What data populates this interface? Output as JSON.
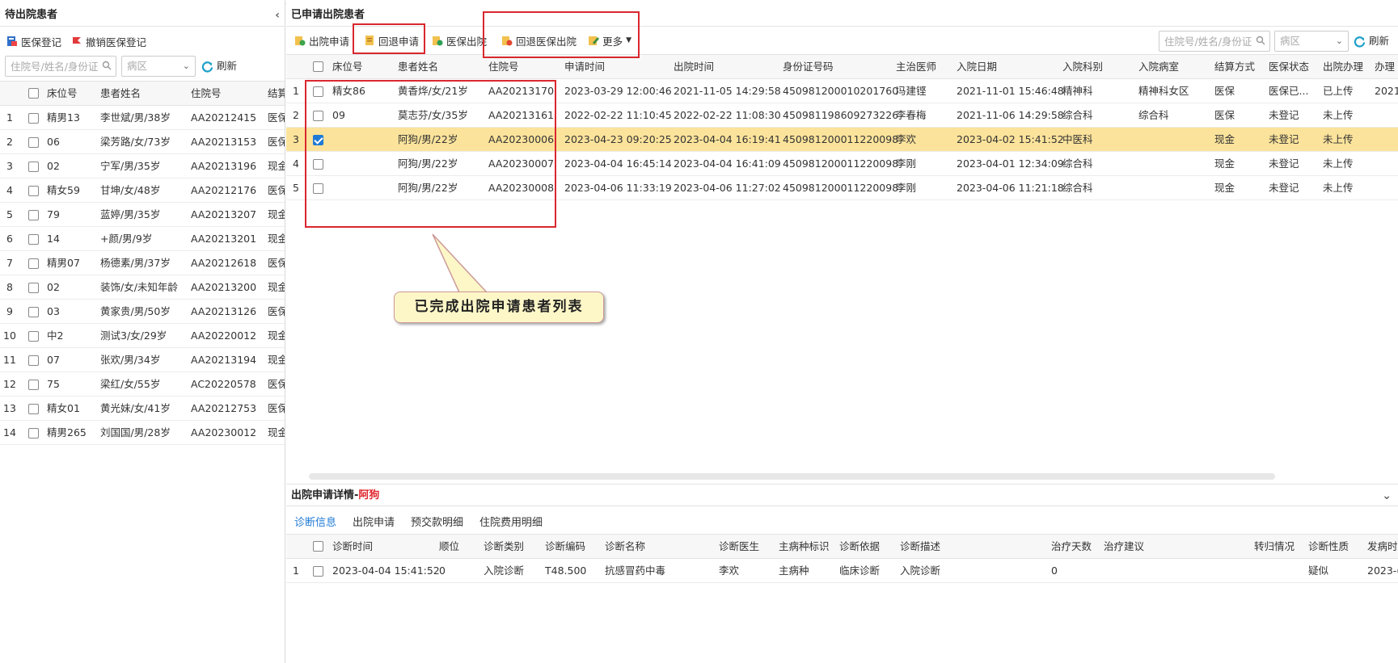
{
  "left": {
    "title": "待出院患者",
    "toolbar": {
      "register": "医保登记",
      "cancel_register": "撤销医保登记"
    },
    "search_placeholder": "住院号/姓名/身份证",
    "ward_placeholder": "病区",
    "refresh": "刷新",
    "columns": [
      "床位号",
      "患者姓名",
      "住院号",
      "结算"
    ],
    "rows": [
      {
        "n": "1",
        "bed": "精男13",
        "name": "李世斌/男/38岁",
        "no": "AA20212415",
        "pay": "医保"
      },
      {
        "n": "2",
        "bed": "06",
        "name": "梁芳路/女/73岁",
        "no": "AA20213153",
        "pay": "医保"
      },
      {
        "n": "3",
        "bed": "02",
        "name": "宁军/男/35岁",
        "no": "AA20213196",
        "pay": "现金"
      },
      {
        "n": "4",
        "bed": "精女59",
        "name": "甘坤/女/48岁",
        "no": "AA20212176",
        "pay": "医保"
      },
      {
        "n": "5",
        "bed": "79",
        "name": "蓝婷/男/35岁",
        "no": "AA20213207",
        "pay": "现金"
      },
      {
        "n": "6",
        "bed": "14",
        "name": "+颜/男/9岁",
        "no": "AA20213201",
        "pay": "现金"
      },
      {
        "n": "7",
        "bed": "精男07",
        "name": "杨德素/男/37岁",
        "no": "AA20212618",
        "pay": "医保"
      },
      {
        "n": "8",
        "bed": "02",
        "name": "装饰/女/未知年龄",
        "no": "AA20213200",
        "pay": "现金"
      },
      {
        "n": "9",
        "bed": "03",
        "name": "黄家贵/男/50岁",
        "no": "AA20213126",
        "pay": "医保"
      },
      {
        "n": "10",
        "bed": "中2",
        "name": "测试3/女/29岁",
        "no": "AA20220012",
        "pay": "现金"
      },
      {
        "n": "11",
        "bed": "07",
        "name": "张欢/男/34岁",
        "no": "AA20213194",
        "pay": "现金"
      },
      {
        "n": "12",
        "bed": "75",
        "name": "梁红/女/55岁",
        "no": "AC20220578",
        "pay": "医保"
      },
      {
        "n": "13",
        "bed": "精女01",
        "name": "黄光妹/女/41岁",
        "no": "AA20212753",
        "pay": "医保"
      },
      {
        "n": "14",
        "bed": "精男265",
        "name": "刘国国/男/28岁",
        "no": "AA20230012",
        "pay": "现金"
      }
    ]
  },
  "right": {
    "title": "已申请出院患者",
    "toolbar": {
      "apply": "出院申请",
      "revert": "回退申请",
      "insurance_discharge": "医保出院",
      "revert_insurance": "回退医保出院",
      "more": "更多"
    },
    "search_placeholder": "住院号/姓名/身份证",
    "ward_placeholder": "病区",
    "refresh": "刷新",
    "columns": [
      "床位号",
      "患者姓名",
      "住院号",
      "申请时间",
      "出院时间",
      "身份证号码",
      "主治医师",
      "入院日期",
      "入院科别",
      "入院病室",
      "结算方式",
      "医保状态",
      "出院办理",
      "办理"
    ],
    "rows": [
      {
        "n": "1",
        "checked": false,
        "bed": "精女86",
        "name": "黄香烨/女/21岁",
        "no": "AA20213170",
        "apply_time": "2023-03-29 12:00:46",
        "out_time": "2021-11-05 14:29:58",
        "id": "450981200010201760",
        "doctor": "冯建铿",
        "in_date": "2021-11-01 15:46:48",
        "dept": "精神科",
        "ward": "精神科女区",
        "pay": "医保",
        "ins": "医保已...",
        "handle": "已上传",
        "extra": "2021"
      },
      {
        "n": "2",
        "checked": false,
        "bed": "09",
        "name": "莫志芬/女/35岁",
        "no": "AA20213161",
        "apply_time": "2022-02-22 11:10:45",
        "out_time": "2022-02-22 11:08:30",
        "id": "450981198609273226",
        "doctor": "李春梅",
        "in_date": "2021-11-06 14:29:58",
        "dept": "综合科",
        "ward": "综合科",
        "pay": "医保",
        "ins": "未登记",
        "handle": "未上传",
        "extra": ""
      },
      {
        "n": "3",
        "checked": true,
        "bed": "",
        "name": "阿狗/男/22岁",
        "no": "AA20230006",
        "apply_time": "2023-04-23 09:20:25",
        "out_time": "2023-04-04 16:19:41",
        "id": "450981200011220098",
        "doctor": "李欢",
        "in_date": "2023-04-02 15:41:52",
        "dept": "中医科",
        "ward": "",
        "pay": "现金",
        "ins": "未登记",
        "handle": "未上传",
        "extra": ""
      },
      {
        "n": "4",
        "checked": false,
        "bed": "",
        "name": "阿狗/男/22岁",
        "no": "AA20230007",
        "apply_time": "2023-04-04 16:45:14",
        "out_time": "2023-04-04 16:41:09",
        "id": "450981200011220098",
        "doctor": "李刚",
        "in_date": "2023-04-01 12:34:09",
        "dept": "综合科",
        "ward": "",
        "pay": "现金",
        "ins": "未登记",
        "handle": "未上传",
        "extra": ""
      },
      {
        "n": "5",
        "checked": false,
        "bed": "",
        "name": "阿狗/男/22岁",
        "no": "AA20230008",
        "apply_time": "2023-04-06 11:33:19",
        "out_time": "2023-04-06 11:27:02",
        "id": "450981200011220098",
        "doctor": "李刚",
        "in_date": "2023-04-06 11:21:18",
        "dept": "综合科",
        "ward": "",
        "pay": "现金",
        "ins": "未登记",
        "handle": "未上传",
        "extra": ""
      }
    ]
  },
  "callout": "已完成出院申请患者列表",
  "detail": {
    "title_prefix": "出院申请详情-",
    "title_name": "阿狗",
    "tabs": [
      "诊断信息",
      "出院申请",
      "预交款明细",
      "住院费用明细"
    ],
    "columns": [
      "诊断时间",
      "顺位",
      "诊断类别",
      "诊断编码",
      "诊断名称",
      "诊断医生",
      "主病种标识",
      "诊断依据",
      "诊断描述",
      "治疗天数",
      "治疗建议",
      "转归情况",
      "诊断性质",
      "发病时"
    ],
    "rows": [
      {
        "n": "1",
        "time": "2023-04-04 15:41:52",
        "order": "0",
        "type": "入院诊断",
        "code": "T48.500",
        "name": "抗感冒药中毒",
        "doctor": "李欢",
        "main": "主病种",
        "basis": "临床诊断",
        "desc": "入院诊断",
        "days": "0",
        "advice": "",
        "outcome": "",
        "nature": "疑似",
        "onset": "2023-("
      }
    ]
  }
}
